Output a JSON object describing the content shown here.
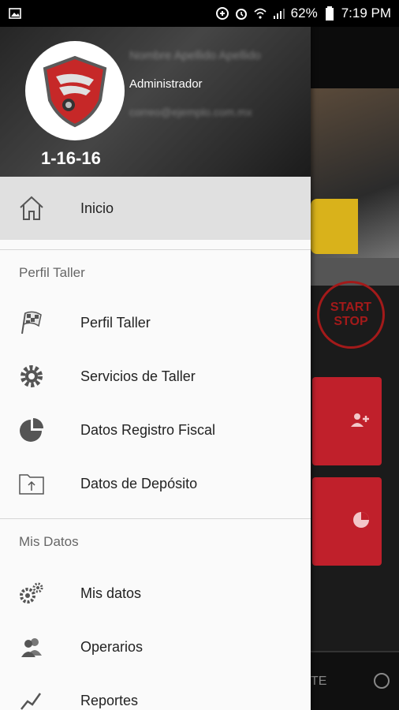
{
  "status_bar": {
    "battery": "62%",
    "time": "7:19 PM"
  },
  "background": {
    "start_stop_line1": "START",
    "start_stop_line2": "STOP",
    "bottom_tab_fragment": "TE"
  },
  "drawer": {
    "role": "Administrador",
    "shop_code": "1-16-16",
    "blurred_name": "Nombre Apellido Apellido",
    "blurred_email": "correo@ejemplo.com.mx"
  },
  "menu": {
    "home": "Inicio",
    "section_taller": "Perfil Taller",
    "perfil_taller": "Perfil Taller",
    "servicios": "Servicios de Taller",
    "registro_fiscal": "Datos Registro Fiscal",
    "deposito": "Datos de Depósito",
    "section_mis_datos": "Mis Datos",
    "mis_datos": "Mis datos",
    "operarios": "Operarios",
    "reportes": "Reportes"
  },
  "colors": {
    "accent_red": "#c0202b",
    "selected_bg": "#e0e0e0",
    "icon_gray": "#555555"
  }
}
